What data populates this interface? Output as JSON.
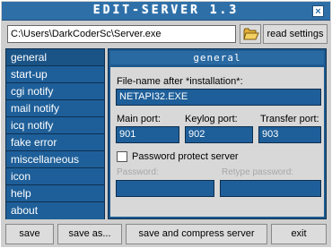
{
  "app": {
    "title": "EDIT-SERVER 1.3",
    "close_glyph": "×"
  },
  "path": {
    "value": "C:\\Users\\DarkCoderSc\\Server.exe",
    "read_label": "read settings"
  },
  "sidebar": {
    "items": [
      {
        "label": "general"
      },
      {
        "label": "start-up"
      },
      {
        "label": "cgi notify"
      },
      {
        "label": "mail notify"
      },
      {
        "label": "icq notify"
      },
      {
        "label": "fake error"
      },
      {
        "label": "miscellaneous"
      },
      {
        "label": "icon"
      },
      {
        "label": "help"
      },
      {
        "label": "about"
      }
    ]
  },
  "general": {
    "header": "general",
    "filename_label": "File-name after *installation*:",
    "filename_value": "NETAPI32.EXE",
    "main_port_label": "Main port:",
    "main_port_value": "901",
    "keylog_port_label": "Keylog port:",
    "keylog_port_value": "902",
    "transfer_port_label": "Transfer port:",
    "transfer_port_value": "903",
    "password_protect_label": "Password protect server",
    "password_label": "Password:",
    "retype_label": "Retype password:"
  },
  "buttons": {
    "save": "save",
    "save_as": "save as...",
    "save_compress": "save and compress server",
    "exit": "exit"
  },
  "colors": {
    "accent": "#1e5a8f",
    "titlebar": "#2e6fa8"
  }
}
